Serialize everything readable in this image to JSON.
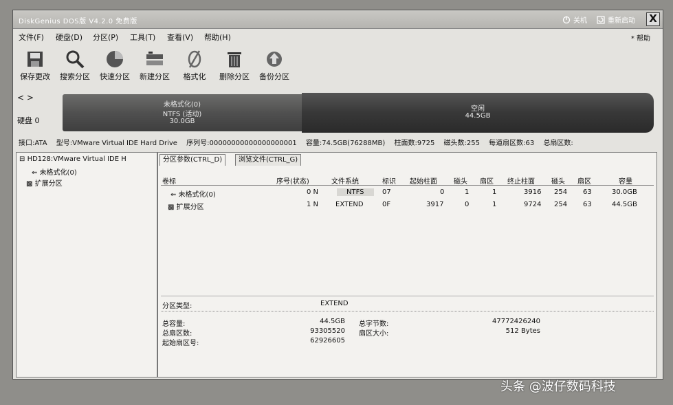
{
  "window": {
    "title": "DiskGenius DOS版 V4.2.0 免费版",
    "links": [
      {
        "label": "关机",
        "icon": "power-icon"
      },
      {
        "label": "重新启动",
        "icon": "restart-icon"
      }
    ],
    "close_glyph": "X"
  },
  "menu": [
    "文件(F)",
    "硬盘(D)",
    "分区(P)",
    "工具(T)",
    "查看(V)",
    "帮助(H)"
  ],
  "help_label": "* 帮助",
  "toolbar": [
    {
      "label": "保存更改",
      "icon": "save-icon"
    },
    {
      "label": "搜索分区",
      "icon": "search-icon"
    },
    {
      "label": "快速分区",
      "icon": "quick-partition-icon"
    },
    {
      "label": "新建分区",
      "icon": "new-partition-icon"
    },
    {
      "label": "格式化",
      "icon": "format-icon"
    },
    {
      "label": "删除分区",
      "icon": "delete-icon"
    },
    {
      "label": "备份分区",
      "icon": "backup-icon"
    }
  ],
  "diskbar": {
    "arrows": "< >",
    "disk_label": "硬盘 0",
    "partition_ntfs": {
      "line1": "未格式化(0)",
      "line2": "NTFS (活动)",
      "line3": "30.0GB"
    },
    "partition_free": {
      "line1": "空闲",
      "line2": "44.5GB"
    }
  },
  "disk_info": {
    "interface": "接口:ATA",
    "model": "型号:VMware Virtual IDE Hard Drive",
    "serial": "序列号:00000000000000000001",
    "capacity": "容量:74.5GB(76288MB)",
    "cylinders": "柱面数:9725",
    "heads": "磁头数:255",
    "sectors_per_track": "每道扇区数:63",
    "total_sectors": "总扇区数:"
  },
  "tree": {
    "disk": "HD128:VMware Virtual IDE H",
    "items": [
      "未格式化(0)",
      "扩展分区"
    ]
  },
  "tabs": [
    "分区参数(CTRL_D)",
    "浏览文件(CTRL_G)"
  ],
  "table": {
    "headers": [
      "卷标",
      "序号(状态)",
      "文件系统",
      "标识",
      "起始柱面",
      "磁头",
      "扇区",
      "终止柱面",
      "磁头",
      "扇区",
      "容量"
    ],
    "rows": [
      [
        "未格式化(0)",
        "0 N",
        "NTFS",
        "07",
        "0",
        "1",
        "1",
        "3916",
        "254",
        "63",
        "30.0GB"
      ],
      [
        "扩展分区",
        "1 N",
        "EXTEND",
        "0F",
        "3917",
        "0",
        "1",
        "9724",
        "254",
        "63",
        "44.5GB"
      ]
    ]
  },
  "details": {
    "type_label": "分区类型:",
    "type_value": "EXTEND",
    "total_capacity_label": "总容量:",
    "total_capacity_value": "44.5GB",
    "total_bytes_label": "总字节数:",
    "total_bytes_value": "47772426240",
    "total_sectors_label": "总扇区数:",
    "total_sectors_value": "93305520",
    "sector_size_label": "扇区大小:",
    "sector_size_value": "512 Bytes",
    "start_sector_label": "起始扇区号:",
    "start_sector_value": "62926605"
  },
  "watermark": "头条 @波仔数码科技"
}
